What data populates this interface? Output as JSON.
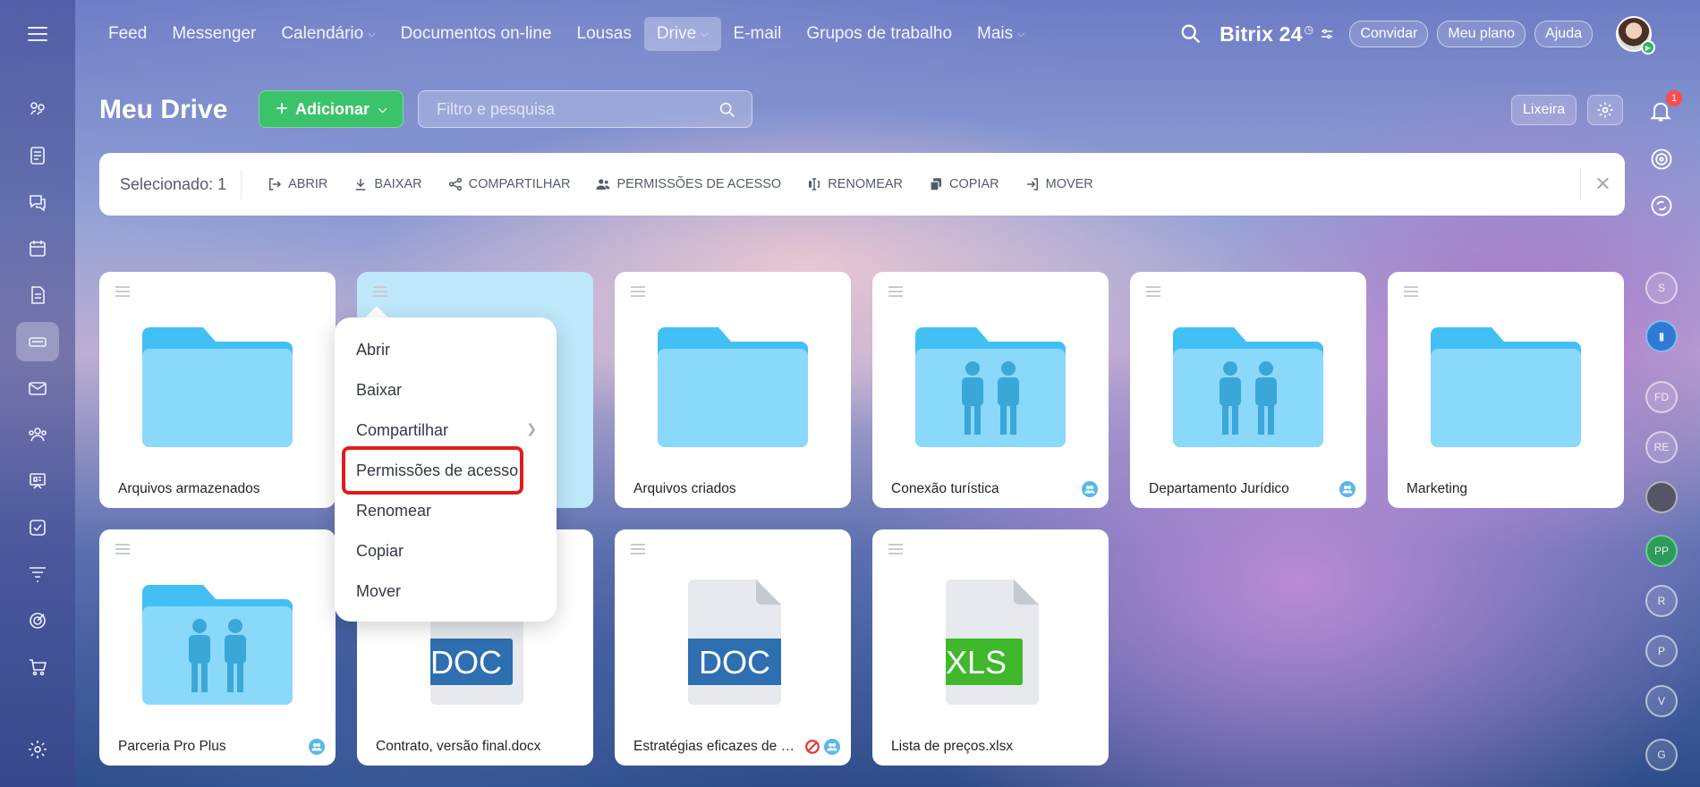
{
  "nav": {
    "items": [
      {
        "label": "Feed"
      },
      {
        "label": "Messenger"
      },
      {
        "label": "Calendário"
      },
      {
        "label": "Documentos on-line"
      },
      {
        "label": "Lousas"
      },
      {
        "label": "Drive"
      },
      {
        "label": "E-mail"
      },
      {
        "label": "Grupos de trabalho"
      },
      {
        "label": "Mais"
      }
    ],
    "brand": "Bitrix",
    "brand_num": "24",
    "invite": "Convidar",
    "plan": "Meu plano",
    "help": "Ajuda"
  },
  "header": {
    "title": "Meu Drive",
    "add_label": "Adicionar",
    "search_placeholder": "Filtro e pesquisa",
    "trash_label": "Lixeira"
  },
  "notifications": {
    "count": "1"
  },
  "toolbar": {
    "selected": "Selecionado: 1",
    "open": "ABRIR",
    "download": "BAIXAR",
    "share": "COMPARTILHAR",
    "permissions": "PERMISSÕES DE ACESSO",
    "rename": "RENOMEAR",
    "copy": "COPIAR",
    "move": "MOVER"
  },
  "tiles": [
    {
      "name": "Arquivos armazenados"
    },
    {
      "name": ""
    },
    {
      "name": "Arquivos criados"
    },
    {
      "name": "Conexão turística"
    },
    {
      "name": "Departamento Jurídico"
    },
    {
      "name": "Marketing"
    },
    {
      "name": "Parceria Pro Plus"
    },
    {
      "name": "Contrato, versão final.docx",
      "label": "DOC"
    },
    {
      "name": "Estratégias eficazes de m...",
      "label": "DOC"
    },
    {
      "name": "Lista de preços.xlsx",
      "label": "XLS"
    }
  ],
  "context_menu": {
    "open": "Abrir",
    "download": "Baixar",
    "share": "Compartilhar",
    "permissions": "Permissões de acesso",
    "rename": "Renomear",
    "copy": "Copiar",
    "move": "Mover"
  },
  "right_chats": [
    "S",
    "FD",
    "RE",
    "PP",
    "R",
    "P",
    "V",
    "G"
  ],
  "colors": {
    "accent_green": "#3bc36b",
    "folder_blue": "#8ad8fa",
    "folder_tab": "#42c0f4",
    "doc_blue": "#2d6fb0",
    "xls_green": "#3fb82b",
    "highlight_red": "#e31b1b",
    "selected_tile": "#bfe8fb"
  }
}
